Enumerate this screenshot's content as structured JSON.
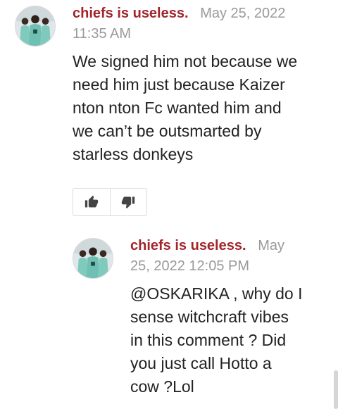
{
  "comments": [
    {
      "author": "chiefs is useless.",
      "date_line1": "May 25, 2022",
      "date_line2": "11:35 AM",
      "body": [
        "We signed him not because we",
        "need him just because Kaizer",
        "nton nton Fc wanted him and",
        "we can’t be outsmarted by",
        "starless donkeys"
      ],
      "avatar_icon": "team-photo-avatar"
    },
    {
      "author": "chiefs is useless.",
      "date_line1": "May",
      "date_line2": "25, 2022 12:05 PM",
      "body": [
        "@OSKARIKA , why do I",
        "sense witchcraft vibes",
        "in this comment ? Did",
        "you just call Hotto a",
        "cow ?Lol"
      ],
      "avatar_icon": "team-photo-avatar"
    }
  ],
  "votes": {
    "upvote_icon": "thumbs-up-icon",
    "downvote_icon": "thumbs-down-icon"
  },
  "colors": {
    "author": "#a3242b",
    "meta": "#9a9a9a",
    "text": "#222222"
  }
}
